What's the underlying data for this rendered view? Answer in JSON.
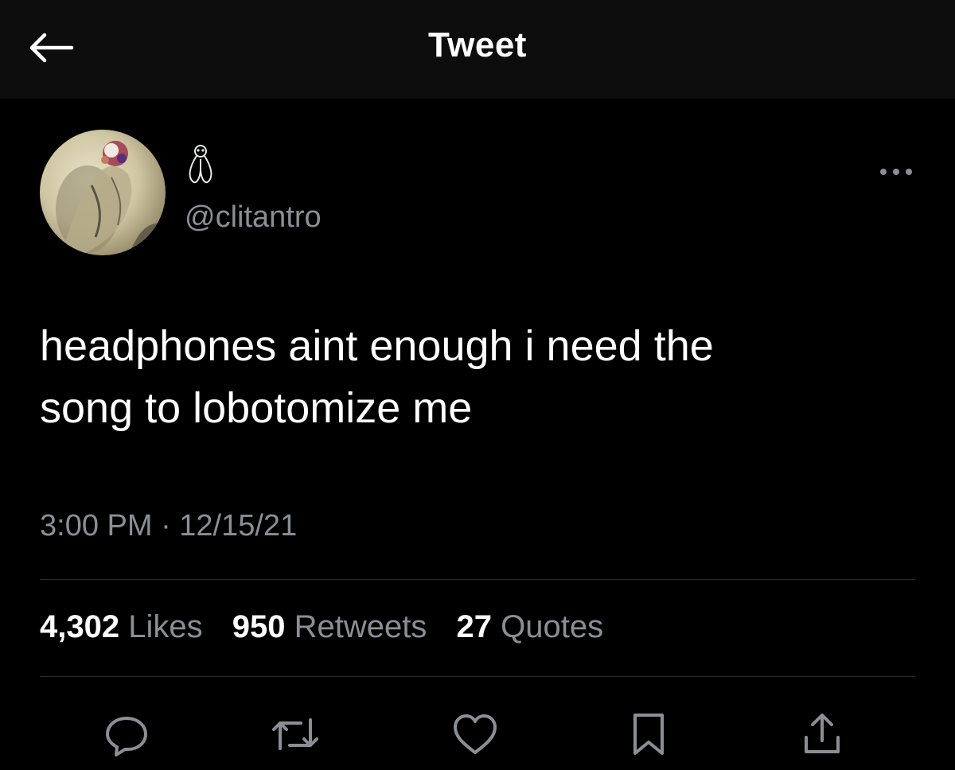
{
  "header": {
    "title": "Tweet",
    "back_icon": "arrow-left-icon"
  },
  "author": {
    "handle": "@clitantro",
    "display_name_glyph": "display-name-emoji-icon",
    "avatar_icon": "avatar-image"
  },
  "tweet": {
    "text_line1": "headphones aint enough i need the",
    "text_line2": "song to lobotomize me",
    "timestamp": "3:00 PM · 12/15/21"
  },
  "stats": {
    "likes_count": "4,302",
    "likes_label": "Likes",
    "retweets_count": "950",
    "retweets_label": "Retweets",
    "quotes_count": "27",
    "quotes_label": "Quotes"
  },
  "actions": [
    {
      "icon": "reply-icon"
    },
    {
      "icon": "retweet-icon"
    },
    {
      "icon": "like-heart-icon"
    },
    {
      "icon": "bookmark-icon"
    },
    {
      "icon": "share-icon"
    }
  ],
  "colors": {
    "background": "#000000",
    "header_background": "#0d0d0d",
    "primary_text": "#ffffff",
    "secondary_text": "#8b8f94",
    "divider": "#2a2d30"
  }
}
